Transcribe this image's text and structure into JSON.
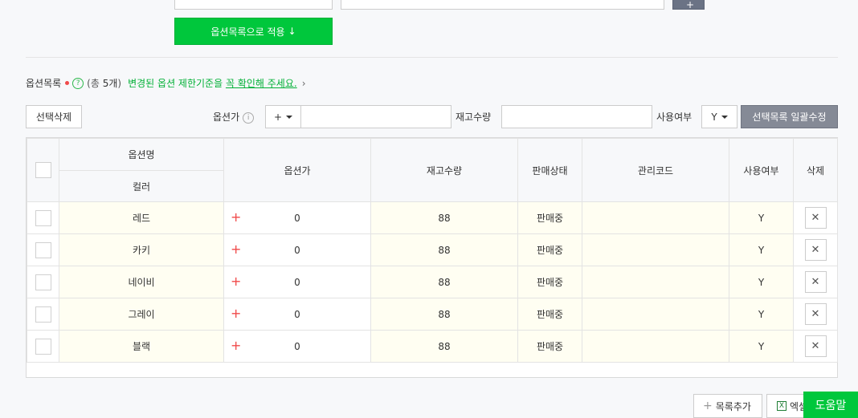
{
  "top": {
    "apply_button": "옵션목록으로 적용",
    "apply_icon": "arrow-down-icon",
    "input1_value": "",
    "input2_value": "",
    "top_button_icon": "plus-icon"
  },
  "option_list": {
    "title": "옵션목록",
    "count_prefix": "(총 ",
    "count": "5개",
    "count_suffix": ")",
    "notice_before": "변경된 옵션 제한기준을 ",
    "notice_link": "꼭 확인해 주세요.",
    "chevron": "›"
  },
  "toolbar": {
    "delete_selected": "선택삭제",
    "price_label": "옵션가",
    "price_sign": "+",
    "stock_label": "재고수량",
    "usage_label": "사용여부",
    "usage_value": "Y",
    "bulk_edit": "선택목록 일괄수정"
  },
  "table": {
    "headers": {
      "option_name": "옵션명",
      "color": "컬러",
      "price": "옵션가",
      "stock": "재고수량",
      "status": "판매상태",
      "code": "관리코드",
      "usage": "사용여부",
      "delete": "삭제"
    },
    "rows": [
      {
        "color": "레드",
        "price": "0",
        "stock": "88",
        "status": "판매중",
        "code": "",
        "usage": "Y"
      },
      {
        "color": "카키",
        "price": "0",
        "stock": "88",
        "status": "판매중",
        "code": "",
        "usage": "Y"
      },
      {
        "color": "네이비",
        "price": "0",
        "stock": "88",
        "status": "판매중",
        "code": "",
        "usage": "Y"
      },
      {
        "color": "그레이",
        "price": "0",
        "stock": "88",
        "status": "판매중",
        "code": "",
        "usage": "Y"
      },
      {
        "color": "블랙",
        "price": "0",
        "stock": "88",
        "status": "판매중",
        "code": "",
        "usage": "Y"
      }
    ]
  },
  "bottom": {
    "add_list": "목록추가",
    "excel": "엑셀",
    "help": "도움말"
  }
}
